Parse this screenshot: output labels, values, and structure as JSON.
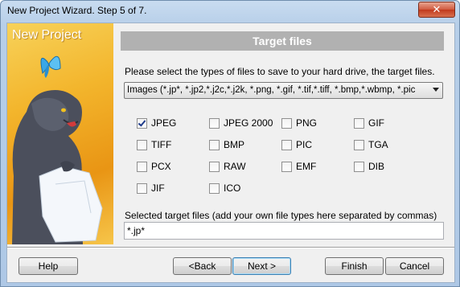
{
  "window": {
    "title": "New Project Wizard. Step 5 of 7.",
    "close_label": "✕"
  },
  "sidebar": {
    "title": "New Project"
  },
  "header": {
    "title": "Target files"
  },
  "instructions": "Please select the types of files to save to your hard drive, the target files.",
  "file_type_select": {
    "value": "Images (*.jp*, *.jp2,*.j2c,*.j2k, *.png, *.gif, *.tif,*.tiff, *.bmp,*.wbmp, *.pic"
  },
  "checkboxes": [
    {
      "label": "JPEG",
      "checked": true
    },
    {
      "label": "JPEG 2000",
      "checked": false
    },
    {
      "label": "PNG",
      "checked": false
    },
    {
      "label": "GIF",
      "checked": false
    },
    {
      "label": "TIFF",
      "checked": false
    },
    {
      "label": "BMP",
      "checked": false
    },
    {
      "label": "PIC",
      "checked": false
    },
    {
      "label": "TGA",
      "checked": false
    },
    {
      "label": "PCX",
      "checked": false
    },
    {
      "label": "RAW",
      "checked": false
    },
    {
      "label": "EMF",
      "checked": false
    },
    {
      "label": "DIB",
      "checked": false
    },
    {
      "label": "JIF",
      "checked": false
    },
    {
      "label": "ICO",
      "checked": false
    }
  ],
  "selected_files": {
    "label": "Selected target files (add your own file types here separated by commas)",
    "value": "*.jp*"
  },
  "buttons": {
    "help": "Help",
    "back": "<Back",
    "next": "Next >",
    "finish": "Finish",
    "cancel": "Cancel"
  }
}
